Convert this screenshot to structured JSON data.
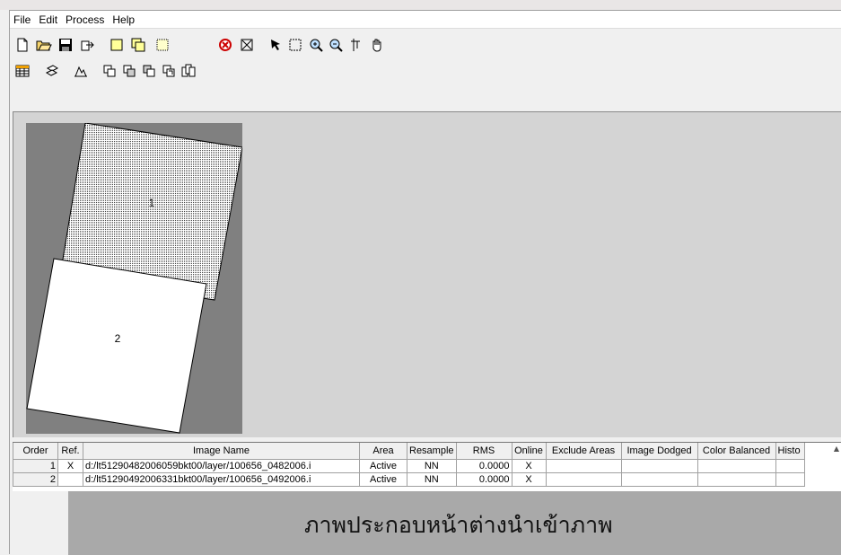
{
  "menu": {
    "items": [
      "File",
      "Edit",
      "Process",
      "Help"
    ]
  },
  "toolbar1": {
    "icons": [
      "new-icon",
      "open-folder-icon",
      "save-icon",
      "export-icon",
      "single-frame-icon",
      "two-frames-icon",
      "dotted-frame-icon",
      "reset-icon",
      "fit-extent-icon",
      "pointer-icon",
      "select-box-icon",
      "zoom-in-icon",
      "zoom-out-icon",
      "pan-crosshair-icon",
      "hand-pan-icon"
    ]
  },
  "toolbar2": {
    "icons": [
      "grid-table-icon",
      "mosaic-tiles-icon",
      "histogram-icon",
      "stack-1-icon",
      "stack-2-icon",
      "stack-3-icon",
      "stack-4-icon",
      "stack-5-icon"
    ]
  },
  "viewer": {
    "image_labels": [
      "1",
      "2"
    ]
  },
  "table": {
    "columns": [
      "Order",
      "Ref.",
      "Image Name",
      "Area",
      "Resample",
      "RMS",
      "Online",
      "Exclude Areas",
      "Image Dodged",
      "Color Balanced",
      "Histo"
    ],
    "rows": [
      {
        "order": "1",
        "ref": "X",
        "name": "d:/lt51290482006059bkt00/layer/100656_0482006.i",
        "area": "Active",
        "resample": "NN",
        "rms": "0.0000",
        "online": "X"
      },
      {
        "order": "2",
        "ref": "",
        "name": "d:/lt51290492006331bkt00/layer/100656_0492006.i",
        "area": "Active",
        "resample": "NN",
        "rms": "0.0000",
        "online": "X"
      }
    ]
  },
  "caption": "ภาพประกอบหน้าต่างนำเข้าภาพ",
  "colors": {
    "canvas": "#808080",
    "viewer_bg": "#d4d4d4",
    "table_gray": "#a9a9a9"
  }
}
